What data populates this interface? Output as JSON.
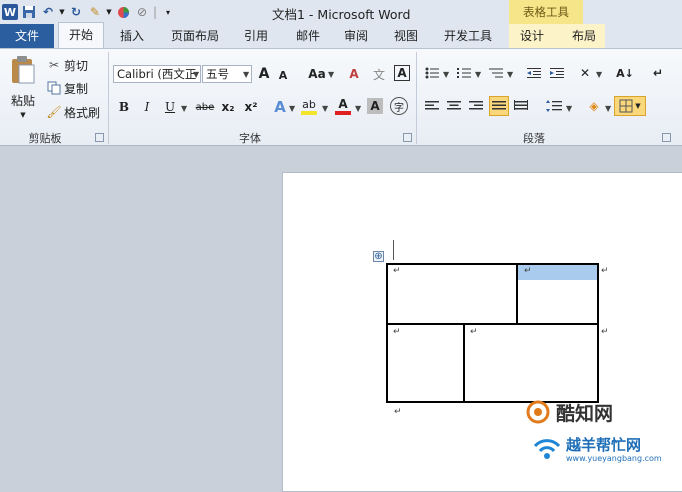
{
  "titlebar": {
    "title": "文档1 - Microsoft Word",
    "contextual_tab": "表格工具",
    "logo": "W"
  },
  "tabs": [
    "文件",
    "开始",
    "插入",
    "页面布局",
    "引用",
    "邮件",
    "审阅",
    "视图",
    "开发工具",
    "设计",
    "布局"
  ],
  "clipboard": {
    "paste": "粘贴",
    "cut": "剪切",
    "copy": "复制",
    "format_painter": "格式刷",
    "group": "剪贴板"
  },
  "font": {
    "name": "Calibri (西文正",
    "size": "五号",
    "grow": "A",
    "shrink": "A",
    "change_case": "Aa",
    "clear_format": "A",
    "phonetic": "文",
    "char_border": "A",
    "bold": "B",
    "italic": "I",
    "underline": "U",
    "strikethrough": "abe",
    "subscript": "x₂",
    "superscript": "x²",
    "text_effects": "A",
    "highlight": "ab",
    "font_color": "A",
    "char_shading": "A",
    "enclose": "字",
    "group": "字体"
  },
  "paragraph": {
    "group": "段落",
    "sort": "A↓"
  },
  "document": {
    "table_move_handle": "⊕",
    "highlight_color": "#a8cbee"
  },
  "watermark": {
    "logo_text": "酷知网",
    "site_text": "越羊帮忙网",
    "site_url": "www.yueyangbang.com"
  },
  "colors": {
    "file_tab": "#2b5e9f",
    "contextual": "#f7e58a",
    "highlight_yellow": "#f9d77a",
    "font_red": "#e02020",
    "highlighter_yellow": "#f2e52a"
  }
}
